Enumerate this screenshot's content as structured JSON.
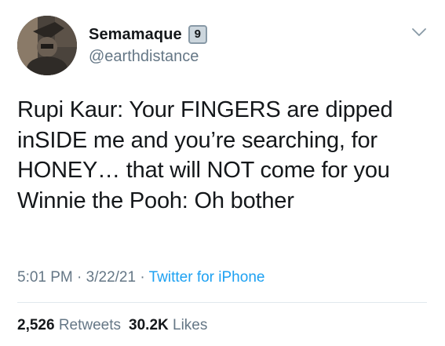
{
  "user": {
    "display_name": "Semamaque",
    "badge": "9",
    "handle": "@earthdistance"
  },
  "icons": {
    "avatar": "profile-photo",
    "menu": "chevron-down-icon"
  },
  "tweet": {
    "lines": [
      "Rupi Kaur: Your FINGERS are dipped",
      "inSIDE me and you’re searching, for",
      "HONEY… that will NOT come for you",
      "Winnie the Pooh: Oh bother"
    ]
  },
  "meta": {
    "time": "5:01 PM",
    "sep1": " · ",
    "date": "3/22/21",
    "sep2": " · ",
    "source": "Twitter for iPhone"
  },
  "stats": {
    "retweets_count": "2,526",
    "retweets_label": "Retweets",
    "likes_count": "30.2K",
    "likes_label": "Likes"
  },
  "colors": {
    "text": "#14171a",
    "secondary": "#657786",
    "link": "#1da1f2",
    "divider": "#e1e8ed"
  }
}
